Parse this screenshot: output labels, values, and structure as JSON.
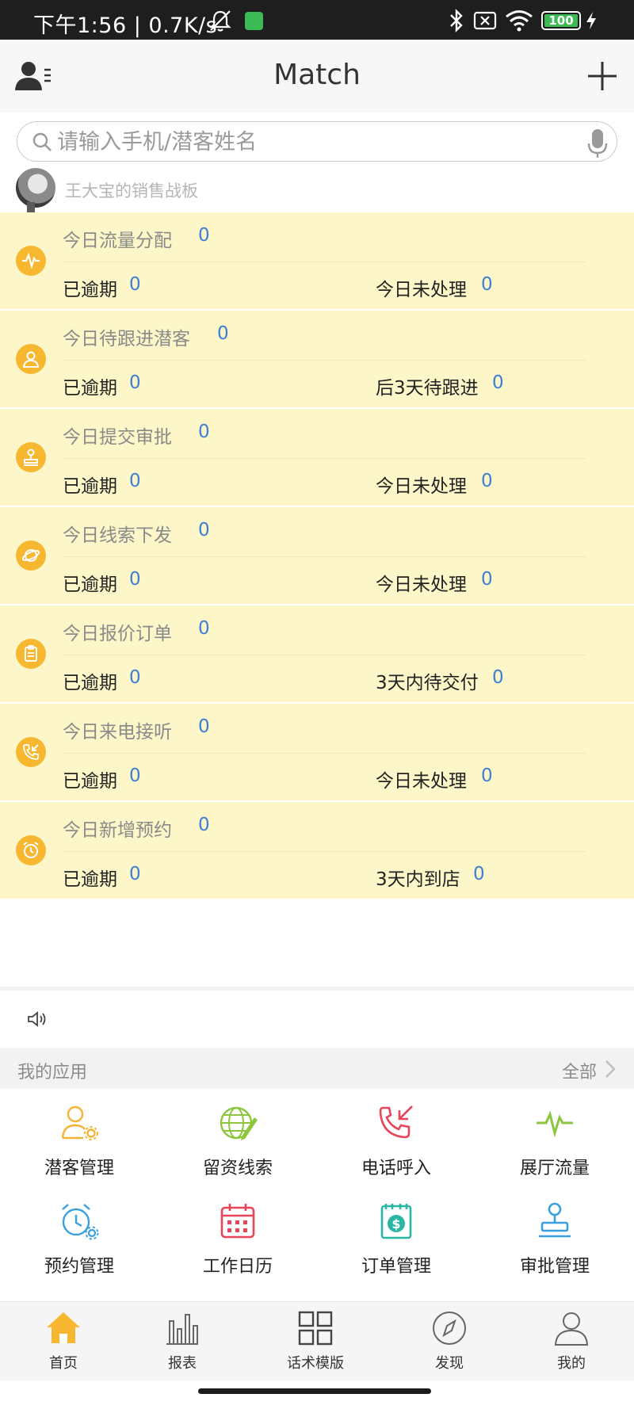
{
  "status_bar": {
    "time": "下午1:56 | 0.7K/s",
    "battery": "100"
  },
  "header": {
    "title": "Match"
  },
  "search": {
    "placeholder": "请输入手机/潜客姓名"
  },
  "board": {
    "title": "王大宝的销售战板"
  },
  "stats": [
    {
      "icon": "pulse-icon",
      "title": "今日流量分配",
      "value": "0",
      "left_label": "已逾期",
      "left_value": "0",
      "right_label": "今日未处理",
      "right_value": "0"
    },
    {
      "icon": "person-icon",
      "title": "今日待跟进潜客",
      "value": "0",
      "left_label": "已逾期",
      "left_value": "0",
      "right_label": "后3天待跟进",
      "right_value": "0"
    },
    {
      "icon": "stamp-icon",
      "title": "今日提交审批",
      "value": "0",
      "left_label": "已逾期",
      "left_value": "0",
      "right_label": "今日未处理",
      "right_value": "0"
    },
    {
      "icon": "planet-icon",
      "title": "今日线索下发",
      "value": "0",
      "left_label": "已逾期",
      "left_value": "0",
      "right_label": "今日未处理",
      "right_value": "0"
    },
    {
      "icon": "clipboard-icon",
      "title": "今日报价订单",
      "value": "0",
      "left_label": "已逾期",
      "left_value": "0",
      "right_label": "3天内待交付",
      "right_value": "0"
    },
    {
      "icon": "incoming-call-icon",
      "title": "今日来电接听",
      "value": "0",
      "left_label": "已逾期",
      "left_value": "0",
      "right_label": "今日未处理",
      "right_value": "0"
    },
    {
      "icon": "alarm-clock-icon",
      "title": "今日新增预约",
      "value": "0",
      "left_label": "已逾期",
      "left_value": "0",
      "right_label": "3天内到店",
      "right_value": "0"
    }
  ],
  "apps": {
    "title": "我的应用",
    "all_label": "全部",
    "items": [
      {
        "label": "潜客管理",
        "icon": "customer-settings-icon",
        "color": "#f5b335"
      },
      {
        "label": "留资线索",
        "icon": "globe-pencil-icon",
        "color": "#8cc63f"
      },
      {
        "label": "电话呼入",
        "icon": "incoming-call-icon",
        "color": "#e8455a"
      },
      {
        "label": "展厅流量",
        "icon": "pulse-icon",
        "color": "#8cc63f"
      },
      {
        "label": "预约管理",
        "icon": "alarm-clock-gear-icon",
        "color": "#3aa0e0"
      },
      {
        "label": "工作日历",
        "icon": "calendar-icon",
        "color": "#e8455a"
      },
      {
        "label": "订单管理",
        "icon": "money-clipboard-icon",
        "color": "#2ab5a5"
      },
      {
        "label": "审批管理",
        "icon": "stamp-icon",
        "color": "#3aa0e0"
      }
    ]
  },
  "bottom_nav": [
    {
      "label": "首页",
      "icon": "home-icon",
      "active": true
    },
    {
      "label": "报表",
      "icon": "bar-chart-icon",
      "active": false
    },
    {
      "label": "话术模版",
      "icon": "grid-icon",
      "active": false
    },
    {
      "label": "发现",
      "icon": "compass-icon",
      "active": false
    },
    {
      "label": "我的",
      "icon": "profile-icon",
      "active": false
    }
  ],
  "colors": {
    "card_bg": "#fcf6c8",
    "value_blue": "#3d7fd6",
    "icon_orange": "#f7b731",
    "home_active": "#f7b731"
  }
}
